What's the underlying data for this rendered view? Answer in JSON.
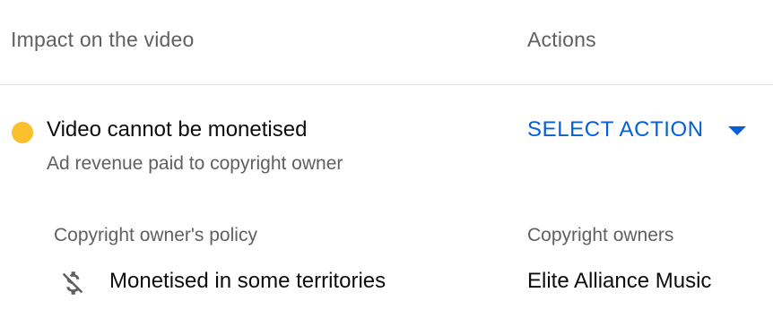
{
  "columns": {
    "impact_header": "Impact on the video",
    "actions_header": "Actions"
  },
  "impact": {
    "status_color": "#fbc02d",
    "title": "Video cannot be monetised",
    "subtitle": "Ad revenue paid to copyright owner"
  },
  "action": {
    "label": "SELECT ACTION",
    "color": "#065fd4",
    "dropdown_icon": "arrow-drop-down-icon"
  },
  "policy": {
    "header": "Copyright owner's policy",
    "icon": "money-off-icon",
    "value": "Monetised in some territories"
  },
  "owners": {
    "header": "Copyright owners",
    "value": "Elite Alliance Music"
  }
}
